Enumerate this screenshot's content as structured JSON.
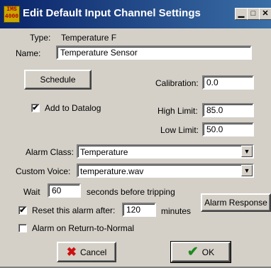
{
  "window": {
    "title": "Edit Default Input Channel Settings",
    "icon_text": "IMS\n4000",
    "minimize": "▁",
    "maximize": "□",
    "close": "✕"
  },
  "type": {
    "label": "Type:",
    "value": "Temperature F"
  },
  "name": {
    "label": "Name:",
    "value": "Temperature Sensor"
  },
  "schedule_button": "Schedule",
  "calibration": {
    "label": "Calibration:",
    "value": "0.0"
  },
  "add_to_datalog": {
    "label": "Add to Datalog",
    "checked": true
  },
  "high_limit": {
    "label": "High Limit:",
    "value": "85.0"
  },
  "low_limit": {
    "label": "Low Limit:",
    "value": "50.0"
  },
  "alarm_class": {
    "label": "Alarm Class:",
    "value": "Temperature"
  },
  "custom_voice": {
    "label": "Custom Voice:",
    "value": "temperature.wav"
  },
  "wait": {
    "label": "Wait",
    "value": "60",
    "suffix": "seconds before tripping"
  },
  "alarm_response_button": "Alarm Response",
  "reset_alarm": {
    "label": "Reset this alarm after:",
    "value": "120",
    "suffix": "minutes",
    "checked": true
  },
  "alarm_on_return": {
    "label": "Alarm on Return-to-Normal",
    "checked": false
  },
  "cancel_button": {
    "label": "Cancel",
    "icon": "x-icon",
    "color": "#cc1010"
  },
  "ok_button": {
    "label": "OK",
    "icon": "checkmark-icon",
    "color": "#1f8a1f"
  },
  "check_glyph": "✔"
}
